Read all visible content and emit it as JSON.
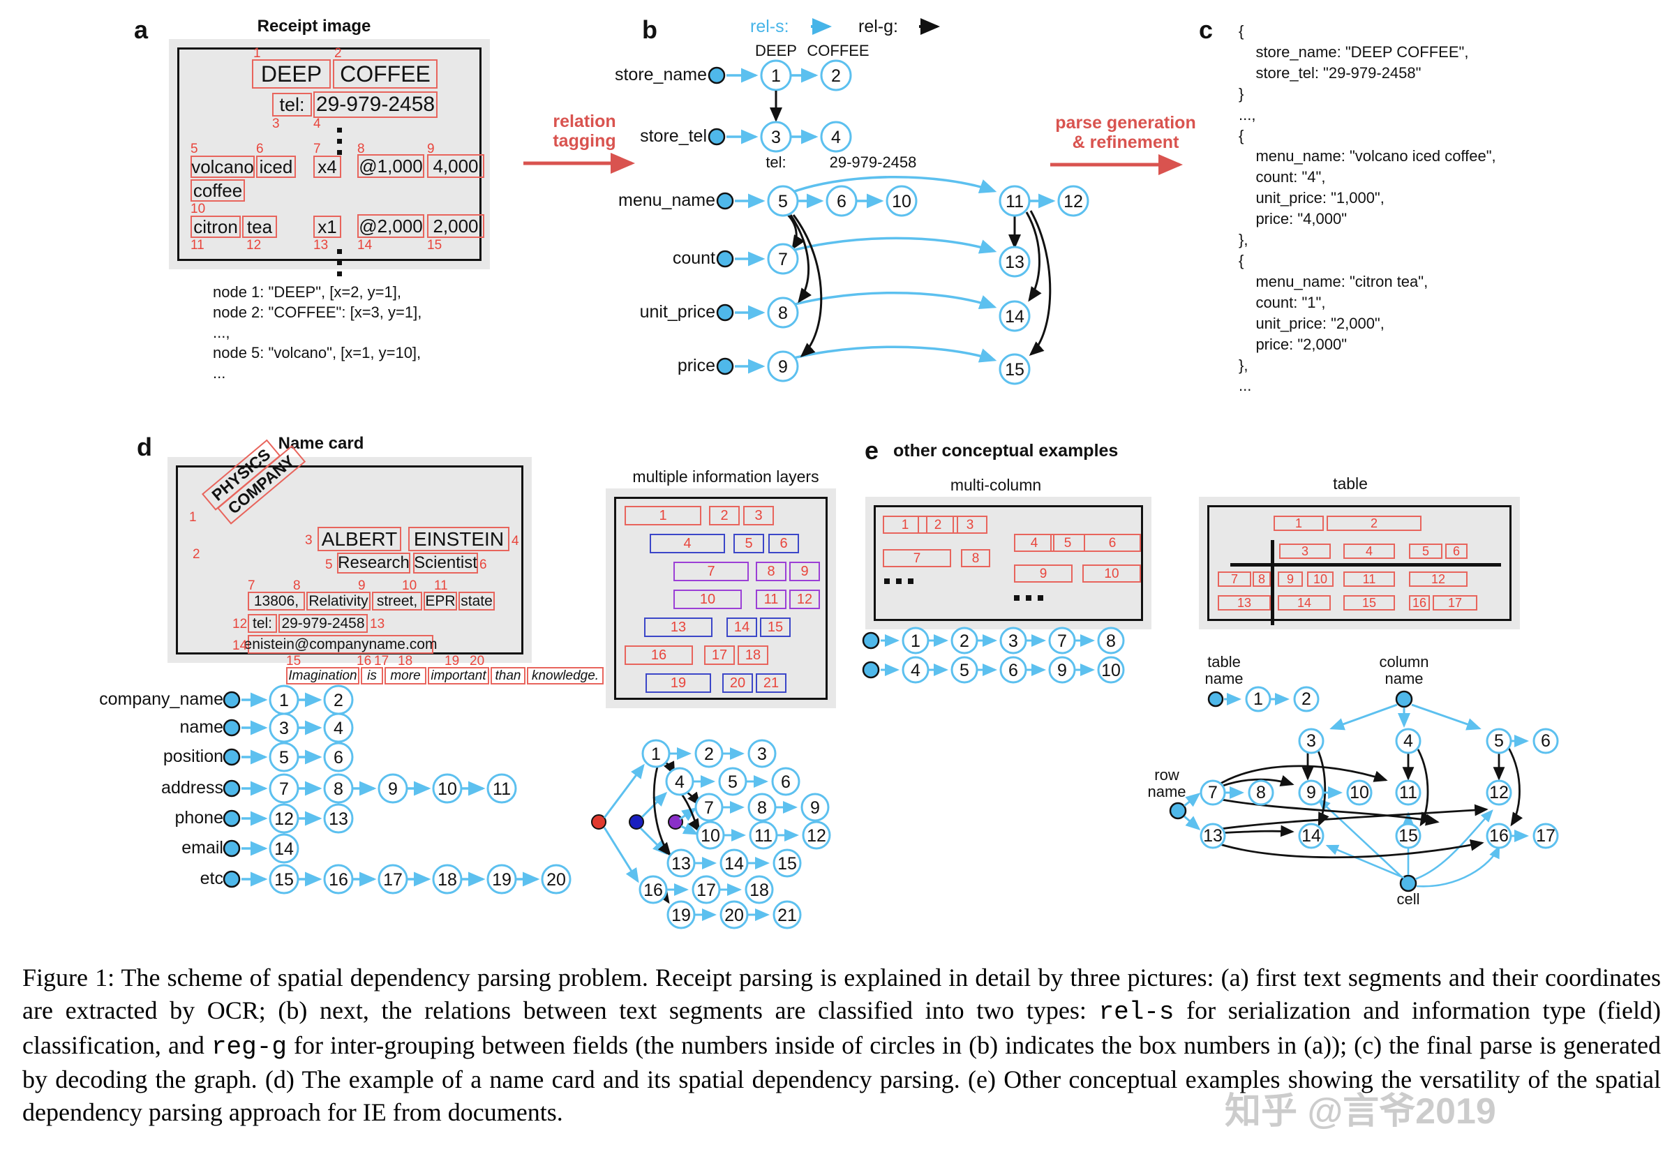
{
  "figure": {
    "caption": "Figure 1: The scheme of spatial dependency parsing problem. Receipt parsing is explained in detail by three pictures: (a) first text segments and their coordinates are extracted by OCR; (b) next, the relations between text segments are classified into two types: rel-s for serialization and information type (field) classification, and reg-g for inter-grouping between fields (the numbers inside of circles in (b) indicates the box numbers in (a)); (c) the final parse is generated by decoding the graph. (d) The example of a name card and its spatial dependency parsing. (e) Other conceptual examples showing the versatility of the spatial dependency parsing approach for IE from documents.",
    "caption_parts": {
      "p1": "Figure 1: The scheme of spatial dependency parsing problem. Receipt parsing is explained in detail by three pictures: (a) first text segments and their coordinates are extracted by OCR; (b) next, the relations between text segments are classified into two types: ",
      "mono1": "rel-s",
      "p2": " for serialization and information type (field) classification, and ",
      "mono2": "reg-g",
      "p3": " for inter-grouping between fields (the numbers inside of circles in (b) indicates the box numbers in (a)); (c) the final parse is generated by decoding the graph. (d) The example of a name card and its spatial dependency parsing. (e) Other conceptual examples showing the versatility of the spatial dependency parsing approach for IE from documents."
    },
    "watermark": "知乎 @言爷2019"
  },
  "colors": {
    "box_red": "#e8645c",
    "index_red": "#e8453c",
    "arrow_red": "#d9534f",
    "rel_s_blue": "#46b4e8",
    "rel_g_black": "#111111",
    "layer_blue": "#3b46c8",
    "layer_purple": "#9b3fd6",
    "node_seed": "#4fb8ea",
    "seed_red": "#e03a2f",
    "seed_blue": "#1a1fc0",
    "seed_purple": "#8a2fc8"
  },
  "panel_a": {
    "letter": "a",
    "title": "Receipt image",
    "boxes": [
      {
        "n": "1",
        "text": "DEEP"
      },
      {
        "n": "2",
        "text": "COFFEE"
      },
      {
        "n": "3",
        "text": "tel:"
      },
      {
        "n": "4",
        "text": "29-979-2458"
      },
      {
        "n": "5",
        "text": "volcano"
      },
      {
        "n": "6",
        "text": "iced"
      },
      {
        "n": "7",
        "text": "x4"
      },
      {
        "n": "8",
        "text": "@1,000"
      },
      {
        "n": "9",
        "text": "4,000"
      },
      {
        "n": "10",
        "text": "coffee"
      },
      {
        "n": "11",
        "text": "citron"
      },
      {
        "n": "12",
        "text": "tea"
      },
      {
        "n": "13",
        "text": "x1"
      },
      {
        "n": "14",
        "text": "@2,000"
      },
      {
        "n": "15",
        "text": "2,000"
      }
    ],
    "node_list": "node 1: \"DEEP\", [x=2, y=1],\nnode 2: \"COFFEE\": [x=3, y=1],\n...,\nnode 5: \"volcano\", [x=1, y=10],\n..."
  },
  "arrow_a_to_b": {
    "label_line1": "relation",
    "label_line2": "tagging"
  },
  "arrow_b_to_c": {
    "label_line1": "parse generation",
    "label_line2": "& refinement"
  },
  "panel_b": {
    "letter": "b",
    "legend": {
      "rel_s": "rel-s:",
      "rel_g": "rel-g:"
    },
    "field_labels": [
      "store_name",
      "store_tel",
      "menu_name",
      "count",
      "unit_price",
      "price"
    ],
    "node_texts": {
      "1": "DEEP",
      "2": "COFFEE",
      "3": "tel:",
      "4": "29-979-2458"
    },
    "nodes": [
      "1",
      "2",
      "3",
      "4",
      "5",
      "6",
      "10",
      "11",
      "12",
      "7",
      "13",
      "8",
      "14",
      "9",
      "15"
    ]
  },
  "panel_c": {
    "letter": "c",
    "code": "{\n    store_name: \"DEEP COFFEE\",\n    store_tel: \"29-979-2458\"\n}\n...,\n{\n    menu_name: \"volcano iced coffee\",\n    count: \"4\",\n    unit_price: \"1,000\",\n    price: \"4,000\"\n},\n{\n    menu_name: \"citron tea\",\n    count: \"1\",\n    unit_price: \"2,000\",\n    price: \"2,000\"\n},\n..."
  },
  "panel_d": {
    "letter": "d",
    "title": "Name card",
    "boxes": [
      {
        "n": "1",
        "text": "PHYSICS"
      },
      {
        "n": "2",
        "text": "COMPANY"
      },
      {
        "n": "3",
        "text": "ALBERT"
      },
      {
        "n": "4",
        "text": "EINSTEIN"
      },
      {
        "n": "5",
        "text": "Research"
      },
      {
        "n": "6",
        "text": "Scientist"
      },
      {
        "n": "7",
        "text": "13806,"
      },
      {
        "n": "8",
        "text": "Relativity"
      },
      {
        "n": "9",
        "text": "street,"
      },
      {
        "n": "10",
        "text": "EPR"
      },
      {
        "n": "11",
        "text": "state"
      },
      {
        "n": "12",
        "text": "tel:"
      },
      {
        "n": "13",
        "text": "29-979-2458"
      },
      {
        "n": "14",
        "text": "enistein@companyname.com"
      },
      {
        "n": "15",
        "text": "Imagination"
      },
      {
        "n": "16",
        "text": "is"
      },
      {
        "n": "17",
        "text": "more"
      },
      {
        "n": "18",
        "text": "important"
      },
      {
        "n": "19",
        "text": "than"
      },
      {
        "n": "20",
        "text": "knowledge."
      }
    ],
    "graph_rows": [
      {
        "label": "company_name",
        "nodes": [
          "1",
          "2"
        ]
      },
      {
        "label": "name",
        "nodes": [
          "3",
          "4"
        ]
      },
      {
        "label": "position",
        "nodes": [
          "5",
          "6"
        ]
      },
      {
        "label": "address",
        "nodes": [
          "7",
          "8",
          "9",
          "10",
          "11"
        ]
      },
      {
        "label": "phone",
        "nodes": [
          "12",
          "13"
        ]
      },
      {
        "label": "email",
        "nodes": [
          "14"
        ]
      },
      {
        "label": "etc",
        "nodes": [
          "15",
          "16",
          "17",
          "18",
          "19",
          "20"
        ]
      }
    ]
  },
  "panel_layers": {
    "title": "multiple information layers",
    "boxes": [
      {
        "n": "1",
        "color": "red"
      },
      {
        "n": "2",
        "color": "red"
      },
      {
        "n": "3",
        "color": "red"
      },
      {
        "n": "4",
        "color": "blue"
      },
      {
        "n": "5",
        "color": "blue"
      },
      {
        "n": "6",
        "color": "blue"
      },
      {
        "n": "7",
        "color": "purple"
      },
      {
        "n": "8",
        "color": "purple"
      },
      {
        "n": "9",
        "color": "purple"
      },
      {
        "n": "10",
        "color": "purple"
      },
      {
        "n": "11",
        "color": "purple"
      },
      {
        "n": "12",
        "color": "purple"
      },
      {
        "n": "13",
        "color": "blue"
      },
      {
        "n": "14",
        "color": "blue"
      },
      {
        "n": "15",
        "color": "blue"
      },
      {
        "n": "16",
        "color": "red"
      },
      {
        "n": "17",
        "color": "red"
      },
      {
        "n": "18",
        "color": "red"
      },
      {
        "n": "19",
        "color": "blue"
      },
      {
        "n": "20",
        "color": "blue"
      },
      {
        "n": "21",
        "color": "blue"
      }
    ],
    "graph_nodes": [
      "1",
      "2",
      "3",
      "4",
      "5",
      "6",
      "7",
      "8",
      "9",
      "10",
      "11",
      "12",
      "13",
      "14",
      "15",
      "16",
      "17",
      "18",
      "19",
      "20",
      "21"
    ]
  },
  "panel_e": {
    "letter": "e",
    "title": "other conceptual examples",
    "multicolumn": {
      "title": "multi-column",
      "boxes": [
        "1",
        "2",
        "3",
        "4",
        "5",
        "6",
        "7",
        "8",
        "9",
        "10"
      ],
      "ellipsis_left": "…",
      "ellipsis_right": "…",
      "graph_rows": [
        {
          "nodes": [
            "1",
            "2",
            "3",
            "7",
            "8"
          ]
        },
        {
          "nodes": [
            "4",
            "5",
            "6",
            "9",
            "10"
          ]
        }
      ]
    },
    "table": {
      "title": "table",
      "boxes": [
        "1",
        "2",
        "3",
        "4",
        "5",
        "6",
        "7",
        "8",
        "9",
        "10",
        "11",
        "12",
        "13",
        "14",
        "15",
        "16",
        "17"
      ],
      "seed_labels": {
        "table_name": "table\nname",
        "column_name": "column\nname",
        "row_name": "row\nname",
        "cell": "cell"
      },
      "seed_label_table_name_l1": "table",
      "seed_label_table_name_l2": "name",
      "seed_label_column_name_l1": "column",
      "seed_label_column_name_l2": "name",
      "seed_label_row_name_l1": "row",
      "seed_label_row_name_l2": "name",
      "seed_label_cell": "cell",
      "graph_nodes": [
        "1",
        "2",
        "3",
        "4",
        "5",
        "6",
        "7",
        "8",
        "9",
        "10",
        "11",
        "12",
        "13",
        "14",
        "15",
        "16",
        "17"
      ]
    }
  }
}
